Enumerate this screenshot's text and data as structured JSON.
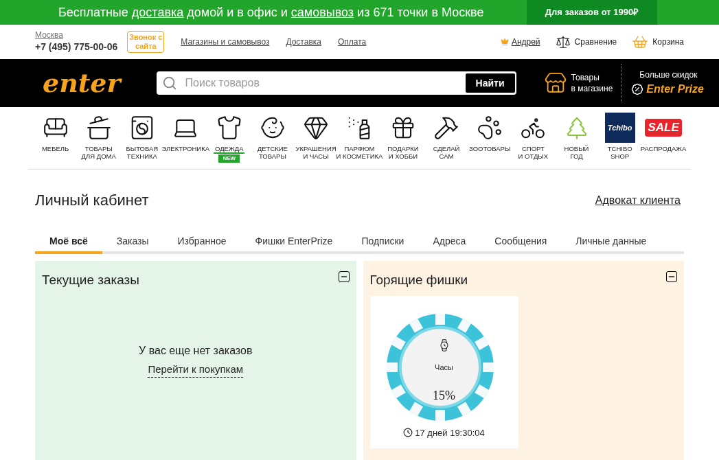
{
  "promo_banner": {
    "parts": [
      {
        "text": "Бесплатные ",
        "link": false
      },
      {
        "text": "доставка",
        "link": true
      },
      {
        "text": " домой и в офис и ",
        "link": false
      },
      {
        "text": "самовывоз",
        "link": true
      },
      {
        "text": " из 671 точки в Москве",
        "link": false
      }
    ],
    "note": "Для заказов от 1990₽"
  },
  "top_bar": {
    "city": "Москва",
    "phone": "+7 (495) 775-00-06",
    "callback": "Звонок с сайта",
    "links": [
      "Магазины и самовывоз",
      "Доставка",
      "Оплата"
    ],
    "user": "Андрей",
    "compare": "Сравнение",
    "cart": "Корзина"
  },
  "header": {
    "logo": "enter",
    "search_placeholder": "Поиск товаров",
    "search_button": "Найти",
    "stores": [
      "Товары",
      "в магазине"
    ],
    "promo_caption": "Больше скидок",
    "promo_name": "Enter Prize"
  },
  "categories": [
    {
      "kind": "pictogram",
      "label": [
        "МЕБЕЛЬ"
      ]
    },
    {
      "kind": "pictogram",
      "label": [
        "ТОВАРЫ",
        "ДЛЯ ДОМА"
      ]
    },
    {
      "kind": "pictogram",
      "label": [
        "БЫТОВАЯ",
        "ТЕХНИКА"
      ]
    },
    {
      "kind": "pictogram",
      "label": [
        "ЭЛЕКТРОНИКА"
      ]
    },
    {
      "kind": "pictogram",
      "label": [
        "ОДЕЖДА"
      ],
      "badge": "NEW"
    },
    {
      "kind": "pictogram",
      "label": [
        "ДЕТСКИЕ",
        "ТОВАРЫ"
      ]
    },
    {
      "kind": "pictogram",
      "label": [
        "УКРАШЕНИЯ",
        "И ЧАСЫ"
      ]
    },
    {
      "kind": "pictogram",
      "label": [
        "ПАРФЮМ",
        "И КОСМЕТИКА"
      ]
    },
    {
      "kind": "pictogram",
      "label": [
        "ПОДАРКИ",
        "И ХОББИ"
      ]
    },
    {
      "kind": "pictogram",
      "label": [
        "СДЕЛАЙ",
        "САМ"
      ]
    },
    {
      "kind": "pictogram",
      "label": [
        "ЗООТОВАРЫ"
      ]
    },
    {
      "kind": "pictogram",
      "label": [
        "СПОРТ",
        "И ОТДЫХ"
      ]
    },
    {
      "kind": "pictogram",
      "label": [
        "НОВЫЙ",
        "ГОД"
      ]
    },
    {
      "kind": "logo",
      "logo_text": "Tchibo",
      "label": [
        "TCHIBO",
        "SHOP"
      ]
    },
    {
      "kind": "logo",
      "logo_text": "SALE",
      "label": [
        "РАСПРОДАЖА"
      ]
    }
  ],
  "page": {
    "title": "Личный кабинет",
    "advocate_link": "Адвокат клиента"
  },
  "tabs": [
    {
      "label": "Моё всё",
      "selected": true
    },
    {
      "label": "Заказы",
      "selected": false
    },
    {
      "label": "Избранное",
      "selected": false
    },
    {
      "label": "Фишки EnterPrize",
      "selected": false
    },
    {
      "label": "Подписки",
      "selected": false
    },
    {
      "label": "Адреса",
      "selected": false
    },
    {
      "label": "Сообщения",
      "selected": false
    },
    {
      "label": "Личные данные",
      "selected": false
    }
  ],
  "panels": [
    {
      "kind": "orders",
      "title": "Текущие заказы",
      "empty_text": "У вас еще нет заказов",
      "link": "Перейти к покупкам"
    },
    {
      "kind": "chips",
      "title": "Горящие фишки",
      "chips": [
        {
          "name": "Часы",
          "discount": "15%",
          "timer": "17 дней 19:30:04"
        }
      ]
    }
  ]
}
